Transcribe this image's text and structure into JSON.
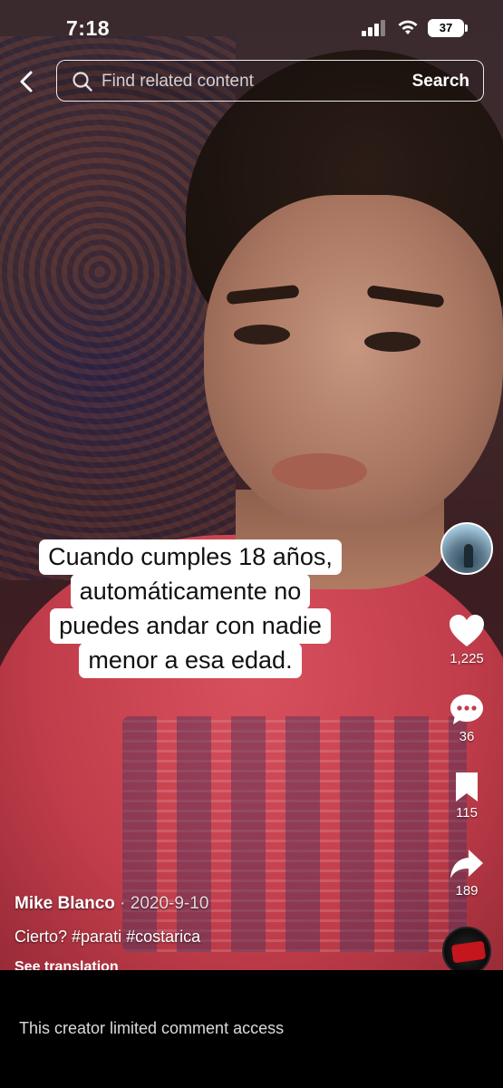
{
  "status_bar": {
    "time": "7:18",
    "battery": "37"
  },
  "search": {
    "placeholder": "Find related content",
    "submit_label": "Search",
    "back_icon": "chevron-left-icon",
    "search_icon": "magnifier-icon"
  },
  "caption": {
    "lines": [
      "Cuando cumples 18 años,",
      "automáticamente no",
      "puedes andar con nadie",
      "menor a esa edad."
    ]
  },
  "actions": {
    "likes": "1,225",
    "comments": "36",
    "saves": "115",
    "shares": "189"
  },
  "post": {
    "author": "Mike Blanco",
    "separator": "·",
    "date": "2020-9-10",
    "description": "Cierto? #parati #costarica",
    "see_translation": "See translation"
  },
  "footer": {
    "comment_notice": "This creator limited comment access"
  },
  "colors": {
    "like_icon": "#ffffff",
    "background": "#000000",
    "shirt": "#c23d4b"
  }
}
